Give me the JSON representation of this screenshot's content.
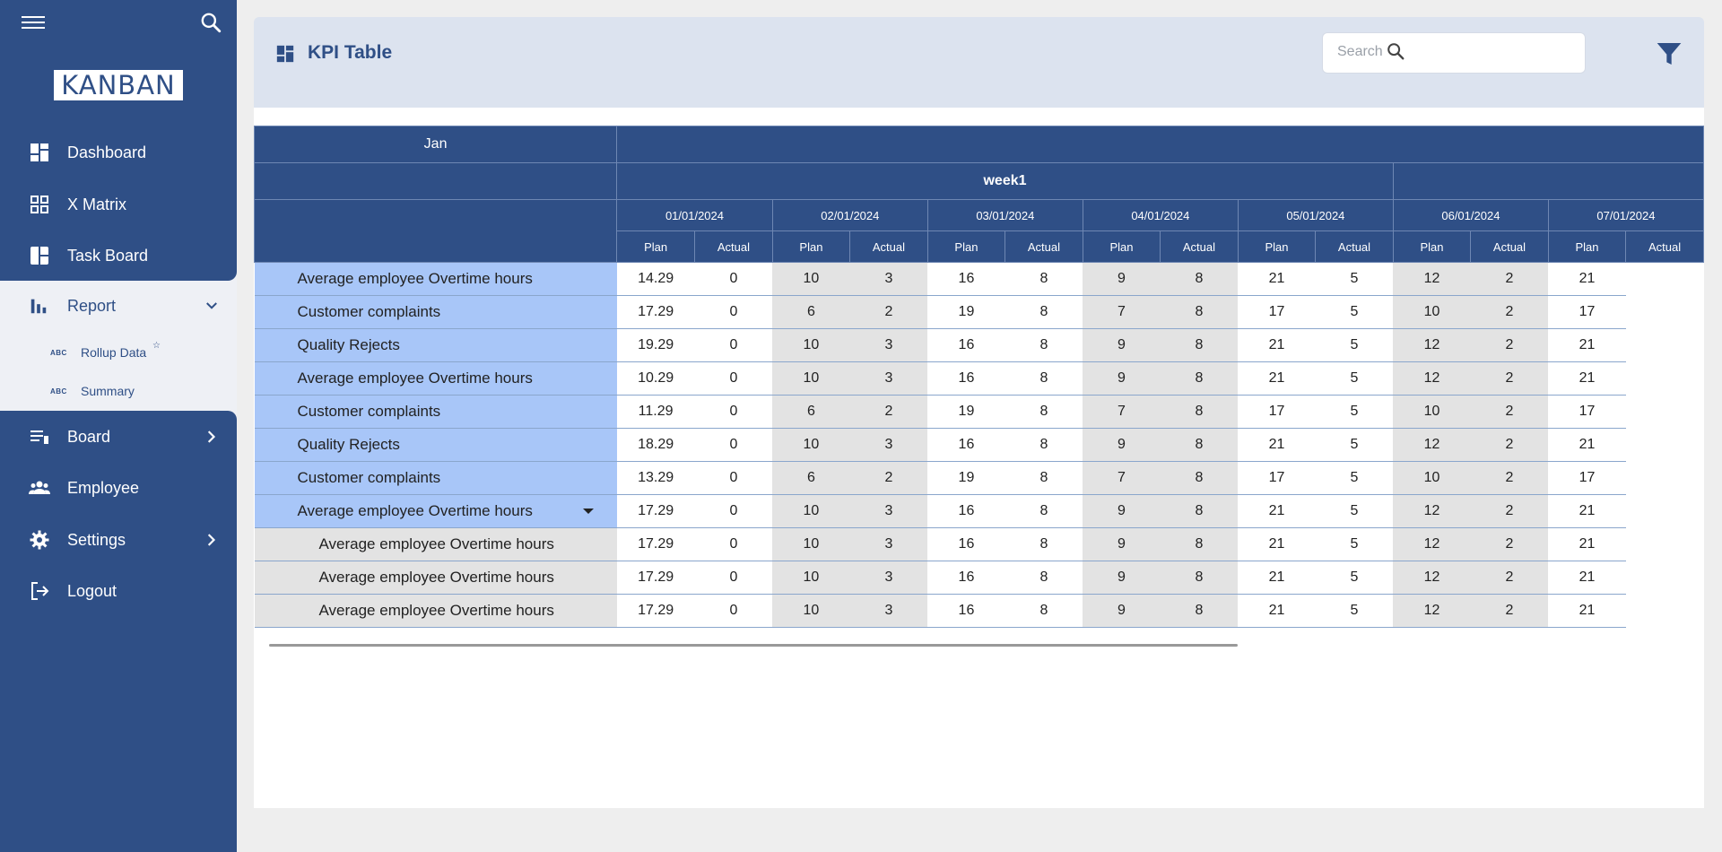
{
  "sidebar": {
    "logo": "KANBAN",
    "items": [
      {
        "label": "Dashboard"
      },
      {
        "label": "X Matrix"
      },
      {
        "label": "Task Board"
      },
      {
        "label": "Report"
      },
      {
        "label": "Board"
      },
      {
        "label": "Employee"
      },
      {
        "label": "Settings"
      },
      {
        "label": "Logout"
      }
    ],
    "report_sub": [
      {
        "abc": "ABC",
        "label": "Rollup Data",
        "star": "☆"
      },
      {
        "abc": "ABC",
        "label": "Summary"
      }
    ]
  },
  "header": {
    "title": "KPI Table",
    "search_placeholder": "Search"
  },
  "table": {
    "month": "Jan",
    "week": "week1",
    "dates": [
      "01/01/2024",
      "02/01/2024",
      "03/01/2024",
      "04/01/2024",
      "05/01/2024",
      "06/01/2024",
      "07/01/2024"
    ],
    "plan_label": "Plan",
    "actual_label": "Actual",
    "rows": [
      {
        "label": "Average employee Overtime hours",
        "values": [
          "14.29",
          "0",
          "10",
          "3",
          "16",
          "8",
          "9",
          "8",
          "21",
          "5",
          "12",
          "2",
          "21"
        ]
      },
      {
        "label": "Customer complaints",
        "values": [
          "17.29",
          "0",
          "6",
          "2",
          "19",
          "8",
          "7",
          "8",
          "17",
          "5",
          "10",
          "2",
          "17"
        ]
      },
      {
        "label": "Quality Rejects",
        "values": [
          "19.29",
          "0",
          "10",
          "3",
          "16",
          "8",
          "9",
          "8",
          "21",
          "5",
          "12",
          "2",
          "21"
        ]
      },
      {
        "label": "Average employee Overtime hours",
        "values": [
          "10.29",
          "0",
          "10",
          "3",
          "16",
          "8",
          "9",
          "8",
          "21",
          "5",
          "12",
          "2",
          "21"
        ]
      },
      {
        "label": "Customer complaints",
        "values": [
          "11.29",
          "0",
          "6",
          "2",
          "19",
          "8",
          "7",
          "8",
          "17",
          "5",
          "10",
          "2",
          "17"
        ]
      },
      {
        "label": "Quality Rejects",
        "values": [
          "18.29",
          "0",
          "10",
          "3",
          "16",
          "8",
          "9",
          "8",
          "21",
          "5",
          "12",
          "2",
          "21"
        ]
      },
      {
        "label": "Customer complaints",
        "values": [
          "13.29",
          "0",
          "6",
          "2",
          "19",
          "8",
          "7",
          "8",
          "17",
          "5",
          "10",
          "2",
          "17"
        ]
      },
      {
        "label": "Average employee Overtime hours",
        "values": [
          "17.29",
          "0",
          "10",
          "3",
          "16",
          "8",
          "9",
          "8",
          "21",
          "5",
          "12",
          "2",
          "21"
        ],
        "expandable": true
      },
      {
        "label": "Average employee Overtime hours",
        "values": [
          "17.29",
          "0",
          "10",
          "3",
          "16",
          "8",
          "9",
          "8",
          "21",
          "5",
          "12",
          "2",
          "21"
        ],
        "child": true
      },
      {
        "label": "Average employee Overtime hours",
        "values": [
          "17.29",
          "0",
          "10",
          "3",
          "16",
          "8",
          "9",
          "8",
          "21",
          "5",
          "12",
          "2",
          "21"
        ],
        "child": true
      },
      {
        "label": "Average employee Overtime hours",
        "values": [
          "17.29",
          "0",
          "10",
          "3",
          "16",
          "8",
          "9",
          "8",
          "21",
          "5",
          "12",
          "2",
          "21"
        ],
        "child": true
      }
    ]
  },
  "colors": {
    "sidebar": "#2f4f86",
    "row_label": "#a8c6f8",
    "child_label": "#e3e3e3",
    "header_bg": "#dce3ef"
  }
}
